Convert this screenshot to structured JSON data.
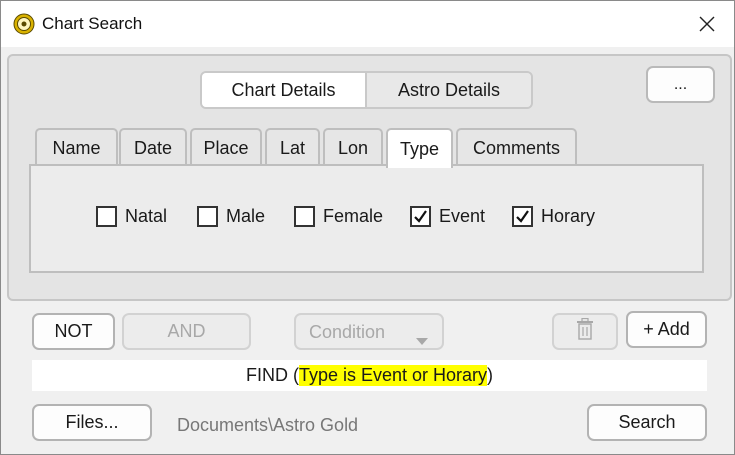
{
  "window": {
    "title": "Chart Search"
  },
  "segments": {
    "chart_details": "Chart Details",
    "astro_details": "Astro Details"
  },
  "more_button": "...",
  "tabs": [
    {
      "label": "Name",
      "active": false
    },
    {
      "label": "Date",
      "active": false
    },
    {
      "label": "Place",
      "active": false
    },
    {
      "label": "Lat",
      "active": false
    },
    {
      "label": "Lon",
      "active": false
    },
    {
      "label": "Type",
      "active": true
    },
    {
      "label": "Comments",
      "active": false
    }
  ],
  "type_options": [
    {
      "label": "Natal",
      "checked": false
    },
    {
      "label": "Male",
      "checked": false
    },
    {
      "label": "Female",
      "checked": false
    },
    {
      "label": "Event",
      "checked": true
    },
    {
      "label": "Horary",
      "checked": true
    }
  ],
  "logic": {
    "not": "NOT",
    "and": "AND",
    "condition": "Condition",
    "add": "+ Add"
  },
  "query": {
    "prefix": "FIND (",
    "highlight": "Type is Event or Horary",
    "suffix": ")"
  },
  "footer": {
    "files": "Files...",
    "path": "Documents\\Astro Gold",
    "search": "Search"
  },
  "colors": {
    "highlight": "#ffff00",
    "icon_gold": "#d9b200"
  }
}
